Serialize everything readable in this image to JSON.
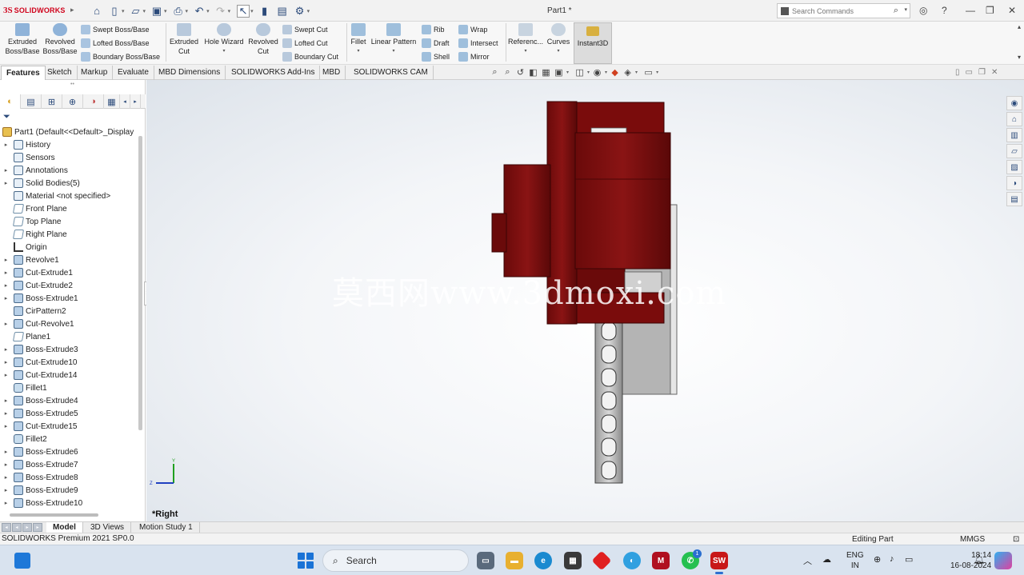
{
  "app": {
    "logo_ds": "3S",
    "logo_name": "SOLIDWORKS",
    "doc_title": "Part1 *",
    "search_placeholder": "Search Commands"
  },
  "quick_access": [
    "home-icon",
    "new-icon",
    "open-icon",
    "save-icon",
    "print-icon",
    "undo-icon",
    "redo-icon",
    "select-icon",
    "rebuild-icon",
    "file-properties-icon",
    "options-icon"
  ],
  "command_manager": {
    "extruded_boss": [
      "Extruded",
      "Boss/Base"
    ],
    "revolved_boss": [
      "Revolved",
      "Boss/Base"
    ],
    "swept_boss": "Swept Boss/Base",
    "lofted_boss": "Lofted Boss/Base",
    "boundary_boss": "Boundary Boss/Base",
    "extruded_cut": [
      "Extruded",
      "Cut"
    ],
    "hole_wizard": "Hole Wizard",
    "revolved_cut": [
      "Revolved",
      "Cut"
    ],
    "swept_cut": "Swept Cut",
    "lofted_cut": "Lofted Cut",
    "boundary_cut": "Boundary Cut",
    "fillet": "Fillet",
    "linear_pattern": "Linear Pattern",
    "rib": "Rib",
    "draft": "Draft",
    "shell": "Shell",
    "wrap": "Wrap",
    "intersect": "Intersect",
    "mirror": "Mirror",
    "reference": "Referenc...",
    "curves": "Curves",
    "instant3d": "Instant3D"
  },
  "tabs": [
    "Features",
    "Sketch",
    "Markup",
    "Evaluate",
    "MBD Dimensions",
    "SOLIDWORKS Add-Ins",
    "MBD",
    "SOLIDWORKS CAM"
  ],
  "tree": {
    "root": "Part1  (Default<<Default>_Display",
    "items": [
      {
        "label": "History",
        "exp": true,
        "kind": "folder"
      },
      {
        "label": "Sensors",
        "exp": false,
        "kind": "folder"
      },
      {
        "label": "Annotations",
        "exp": true,
        "kind": "folder"
      },
      {
        "label": "Solid Bodies(5)",
        "exp": true,
        "kind": "folder"
      },
      {
        "label": "Material <not specified>",
        "exp": false,
        "kind": "folder"
      },
      {
        "label": "Front Plane",
        "exp": false,
        "kind": "plane"
      },
      {
        "label": "Top Plane",
        "exp": false,
        "kind": "plane"
      },
      {
        "label": "Right Plane",
        "exp": false,
        "kind": "plane"
      },
      {
        "label": "Origin",
        "exp": false,
        "kind": "origin"
      },
      {
        "label": "Revolve1",
        "exp": true,
        "kind": "feat"
      },
      {
        "label": "Cut-Extrude1",
        "exp": true,
        "kind": "feat"
      },
      {
        "label": "Cut-Extrude2",
        "exp": true,
        "kind": "feat"
      },
      {
        "label": "Boss-Extrude1",
        "exp": true,
        "kind": "feat"
      },
      {
        "label": "CirPattern2",
        "exp": false,
        "kind": "feat"
      },
      {
        "label": "Cut-Revolve1",
        "exp": true,
        "kind": "feat"
      },
      {
        "label": "Plane1",
        "exp": false,
        "kind": "plane"
      },
      {
        "label": "Boss-Extrude3",
        "exp": true,
        "kind": "feat"
      },
      {
        "label": "Cut-Extrude10",
        "exp": true,
        "kind": "feat"
      },
      {
        "label": "Cut-Extrude14",
        "exp": true,
        "kind": "feat"
      },
      {
        "label": "Fillet1",
        "exp": false,
        "kind": "fillet"
      },
      {
        "label": "Boss-Extrude4",
        "exp": true,
        "kind": "feat"
      },
      {
        "label": "Boss-Extrude5",
        "exp": true,
        "kind": "feat"
      },
      {
        "label": "Cut-Extrude15",
        "exp": true,
        "kind": "feat"
      },
      {
        "label": "Fillet2",
        "exp": false,
        "kind": "fillet"
      },
      {
        "label": "Boss-Extrude6",
        "exp": true,
        "kind": "feat"
      },
      {
        "label": "Boss-Extrude7",
        "exp": true,
        "kind": "feat"
      },
      {
        "label": "Boss-Extrude8",
        "exp": true,
        "kind": "feat"
      },
      {
        "label": "Boss-Extrude9",
        "exp": true,
        "kind": "feat"
      },
      {
        "label": "Boss-Extrude10",
        "exp": true,
        "kind": "feat"
      }
    ]
  },
  "viewport": {
    "watermark": "莫西网www.3dmoxi.com",
    "view_label": "*Right",
    "triad_y": "Y",
    "triad_z": "Z",
    "model_color": "#7a0c0c"
  },
  "bottom_tabs": [
    "Model",
    "3D Views",
    "Motion Study 1"
  ],
  "status": {
    "product": "SOLIDWORKS Premium 2021 SP0.0",
    "mode": "Editing Part",
    "units": "MMGS"
  },
  "taskbar": {
    "search_label": "Search",
    "lang_line1": "ENG",
    "lang_line2": "IN",
    "time": "18:14",
    "date": "16-08-2024",
    "whatsapp_badge": "1"
  }
}
